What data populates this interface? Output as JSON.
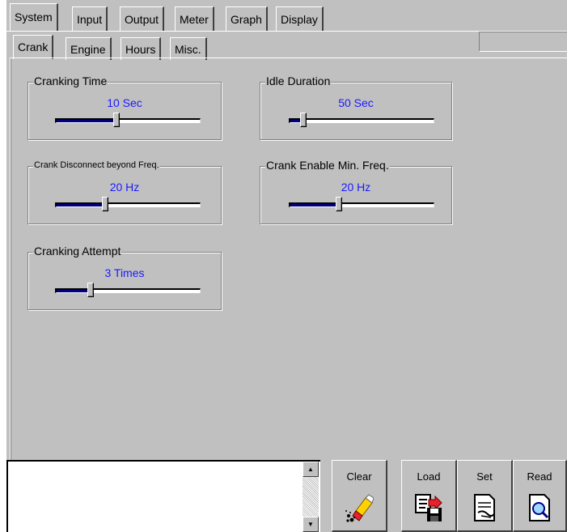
{
  "tabs": [
    "System",
    "Input",
    "Output",
    "Meter",
    "Graph",
    "Display"
  ],
  "active_tab": "System",
  "subtabs": [
    "Crank",
    "Engine",
    "Hours",
    "Misc."
  ],
  "active_subtab": "Crank",
  "groups": {
    "cranking_time": {
      "title": "Cranking Time",
      "value": "10 Sec",
      "level": 0.42
    },
    "idle_duration": {
      "title": "Idle Duration",
      "value": "50 Sec",
      "level": 0.09
    },
    "crank_disconnect": {
      "title": "Crank Disconnect beyond Freq.",
      "value": "20 Hz",
      "level": 0.34
    },
    "crank_enable": {
      "title": "Crank Enable Min. Freq.",
      "value": "20 Hz",
      "level": 0.34
    },
    "cranking_attempt": {
      "title": "Cranking Attempt",
      "value": "3 Times",
      "level": 0.24
    }
  },
  "buttons": {
    "clear": {
      "label": "Clear",
      "icon": "eraser-icon"
    },
    "load": {
      "label": "Load",
      "icon": "load-disk-icon"
    },
    "set": {
      "label": "Set",
      "icon": "set-document-icon"
    },
    "read": {
      "label": "Read",
      "icon": "read-magnifier-icon"
    }
  },
  "colors": {
    "value_text": "#1a1aff",
    "slider_fill": "#00007f",
    "background": "#c0c0c0"
  }
}
